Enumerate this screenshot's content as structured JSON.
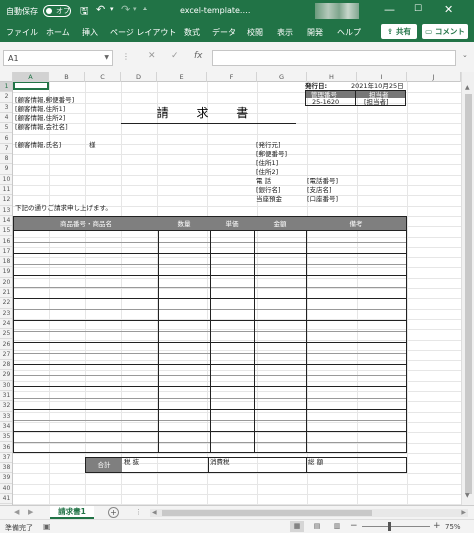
{
  "titlebar": {
    "autosave_label": "自動保存",
    "autosave_state": "オフ",
    "filename": "excel-template.…",
    "colors": {
      "brand": "#217346"
    }
  },
  "menu": {
    "items": [
      "ファイル",
      "ホーム",
      "挿入",
      "ページ レイアウト",
      "数式",
      "データ",
      "校閲",
      "表示",
      "開発",
      "ヘルプ"
    ],
    "share_label": "共有",
    "comment_label": "コメント"
  },
  "formula_bar": {
    "namebox": "A1",
    "fx": "fx",
    "value": ""
  },
  "columns": [
    "A",
    "B",
    "C",
    "D",
    "E",
    "F",
    "G",
    "H",
    "I",
    "J"
  ],
  "rows": [
    "1",
    "2",
    "3",
    "4",
    "5",
    "6",
    "7",
    "8",
    "9",
    "10",
    "11",
    "12",
    "13",
    "14",
    "15",
    "16",
    "17",
    "18",
    "19",
    "20",
    "21",
    "22",
    "23",
    "24",
    "25",
    "26",
    "27",
    "28",
    "29",
    "30",
    "31",
    "32",
    "33",
    "34",
    "35",
    "36",
    "37",
    "38",
    "39",
    "40",
    "41"
  ],
  "invoice": {
    "title": "請 求 書",
    "issue_date_label": "発行日:",
    "issue_date": "2021年10月25日",
    "mgmt_no_label": "管理番号",
    "staff_label": "担当者",
    "mgmt_no": "25-1620",
    "staff_value": "[担当者]",
    "client": {
      "postal": "[顧客情報,郵便番号]",
      "address1": "[顧客情報,住所1]",
      "address2": "[顧客情報,住所2]",
      "company": "[顧客情報,会社名]",
      "name": "[顧客情報,氏名]",
      "honorific": "様"
    },
    "issuer": {
      "name": "[発行元]",
      "postal": "[郵便番号]",
      "address1": "[住所1]",
      "address2": "[住所2]",
      "tel_label": "電 話",
      "tel": "[電話番号]",
      "bank_label": "[銀行名]",
      "branch": "[支店名]",
      "account_label": "当座預金",
      "account": "[口座番号]"
    },
    "message": "下記の通りご請求申し上げます。",
    "table_headers": [
      "商品番号・商品名",
      "数量",
      "単価",
      "金額",
      "備考"
    ],
    "totals": {
      "total_label": "合計",
      "subtotal_label": "税 抜",
      "tax_label": "消費税",
      "grand_label": "総 額"
    }
  },
  "sheet_tabs": [
    "請求書1"
  ],
  "status": {
    "ready": "準備完了",
    "zoom": "75%"
  }
}
